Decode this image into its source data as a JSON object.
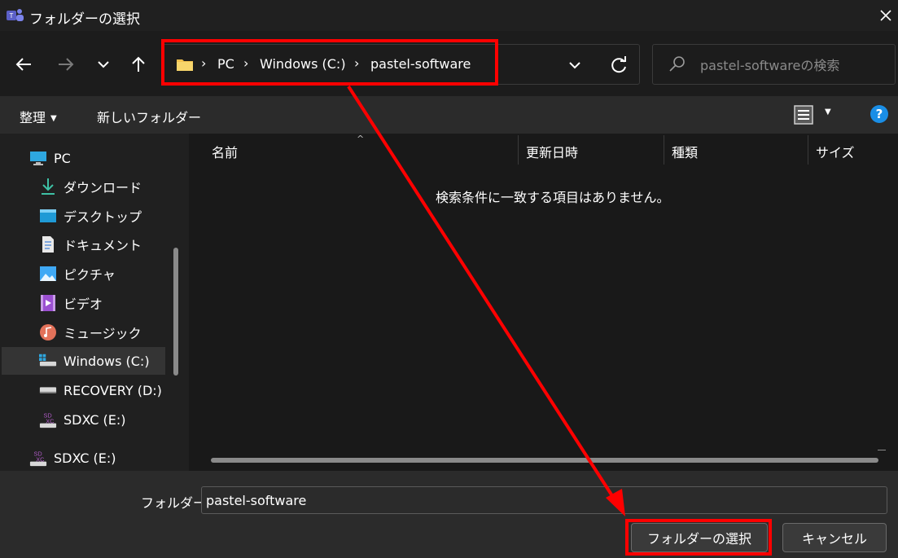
{
  "window": {
    "title": "フォルダーの選択"
  },
  "nav": {
    "breadcrumbs": [
      "PC",
      "Windows (C:)",
      "pastel-software"
    ],
    "search_placeholder": "pastel-softwareの検索"
  },
  "toolbar": {
    "organize": "整理",
    "new_folder": "新しいフォルダー"
  },
  "sidebar": {
    "items": [
      {
        "label": "PC",
        "icon": "pc-icon"
      },
      {
        "label": "ダウンロード",
        "icon": "download-icon"
      },
      {
        "label": "デスクトップ",
        "icon": "desktop-icon"
      },
      {
        "label": "ドキュメント",
        "icon": "document-icon"
      },
      {
        "label": "ピクチャ",
        "icon": "picture-icon"
      },
      {
        "label": "ビデオ",
        "icon": "video-icon"
      },
      {
        "label": "ミュージック",
        "icon": "music-icon"
      },
      {
        "label": "Windows (C:)",
        "icon": "drive-icon",
        "selected": true
      },
      {
        "label": "RECOVERY (D:)",
        "icon": "drive-icon"
      },
      {
        "label": "SDXC (E:)",
        "icon": "sd-card-icon"
      },
      {
        "label": "SDXC (E:)",
        "icon": "sd-card-icon"
      }
    ]
  },
  "content": {
    "columns": [
      "名前",
      "更新日時",
      "種類",
      "サイズ"
    ],
    "empty_message": "検索条件に一致する項目はありません。"
  },
  "bottom": {
    "folder_label": "フォルダー:",
    "folder_value": "pastel-software",
    "select_button": "フォルダーの選択",
    "cancel_button": "キャンセル"
  },
  "colors": {
    "highlight": "#ff0000",
    "accent": "#1a8ee6",
    "folder": "#f2c14e"
  }
}
